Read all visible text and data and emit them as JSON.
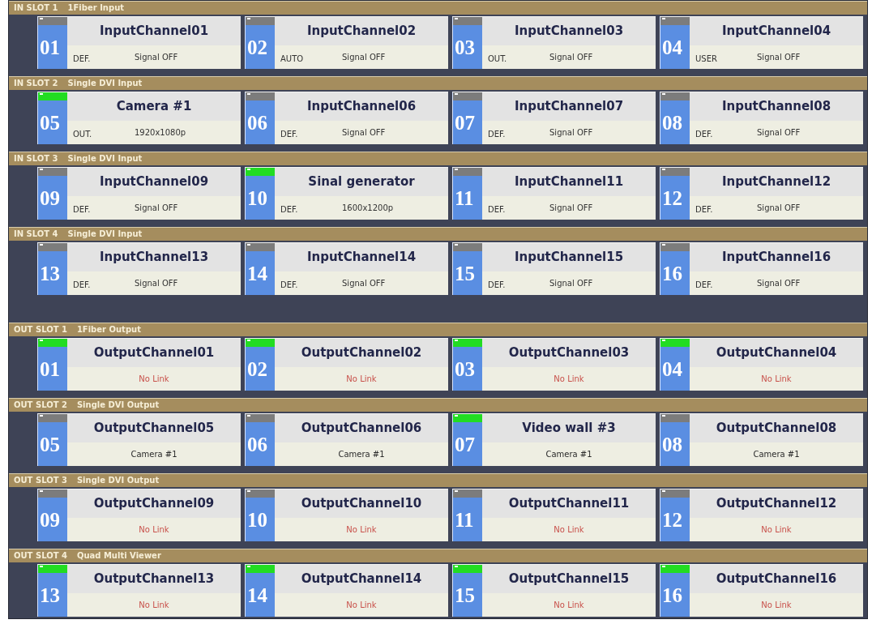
{
  "input_slots": [
    {
      "label": "IN SLOT 1",
      "module": "1Fiber Input",
      "channels": [
        {
          "number": "01",
          "name": "InputChannel01",
          "mode": "DEF.",
          "status": "Signal OFF",
          "active": false
        },
        {
          "number": "02",
          "name": "InputChannel02",
          "mode": "AUTO",
          "status": "Signal OFF",
          "active": false
        },
        {
          "number": "03",
          "name": "InputChannel03",
          "mode": "OUT.",
          "status": "Signal OFF",
          "active": false
        },
        {
          "number": "04",
          "name": "InputChannel04",
          "mode": "USER",
          "status": "Signal OFF",
          "active": false
        }
      ]
    },
    {
      "label": "IN SLOT 2",
      "module": "Single DVI Input",
      "channels": [
        {
          "number": "05",
          "name": "Camera #1",
          "mode": "OUT.",
          "status": "1920x1080p",
          "active": true
        },
        {
          "number": "06",
          "name": "InputChannel06",
          "mode": "DEF.",
          "status": "Signal OFF",
          "active": false
        },
        {
          "number": "07",
          "name": "InputChannel07",
          "mode": "DEF.",
          "status": "Signal OFF",
          "active": false
        },
        {
          "number": "08",
          "name": "InputChannel08",
          "mode": "DEF.",
          "status": "Signal OFF",
          "active": false
        }
      ]
    },
    {
      "label": "IN SLOT 3",
      "module": "Single DVI Input",
      "channels": [
        {
          "number": "09",
          "name": "InputChannel09",
          "mode": "DEF.",
          "status": "Signal OFF",
          "active": false
        },
        {
          "number": "10",
          "name": "Sinal generator",
          "mode": "DEF.",
          "status": "1600x1200p",
          "active": true
        },
        {
          "number": "11",
          "name": "InputChannel11",
          "mode": "DEF.",
          "status": "Signal OFF",
          "active": false
        },
        {
          "number": "12",
          "name": "InputChannel12",
          "mode": "DEF.",
          "status": "Signal OFF",
          "active": false
        }
      ]
    },
    {
      "label": "IN SLOT 4",
      "module": "Single DVI Input",
      "channels": [
        {
          "number": "13",
          "name": "InputChannel13",
          "mode": "DEF.",
          "status": "Signal OFF",
          "active": false
        },
        {
          "number": "14",
          "name": "InputChannel14",
          "mode": "DEF.",
          "status": "Signal OFF",
          "active": false
        },
        {
          "number": "15",
          "name": "InputChannel15",
          "mode": "DEF.",
          "status": "Signal OFF",
          "active": false
        },
        {
          "number": "16",
          "name": "InputChannel16",
          "mode": "DEF.",
          "status": "Signal OFF",
          "active": false
        }
      ]
    }
  ],
  "output_slots": [
    {
      "label": "OUT SLOT 1",
      "module": "1Fiber Output",
      "channels": [
        {
          "number": "01",
          "name": "OutputChannel01",
          "status": "No Link",
          "kind": "no-link",
          "active": true
        },
        {
          "number": "02",
          "name": "OutputChannel02",
          "status": "No Link",
          "kind": "no-link",
          "active": true
        },
        {
          "number": "03",
          "name": "OutputChannel03",
          "status": "No Link",
          "kind": "no-link",
          "active": true
        },
        {
          "number": "04",
          "name": "OutputChannel04",
          "status": "No Link",
          "kind": "no-link",
          "active": true
        }
      ]
    },
    {
      "label": "OUT SLOT 2",
      "module": "Single DVI Output",
      "channels": [
        {
          "number": "05",
          "name": "OutputChannel05",
          "status": "Camera #1",
          "kind": "source",
          "active": false
        },
        {
          "number": "06",
          "name": "OutputChannel06",
          "status": "Camera #1",
          "kind": "source",
          "active": false
        },
        {
          "number": "07",
          "name": "Video wall #3",
          "status": "Camera #1",
          "kind": "source",
          "active": true
        },
        {
          "number": "08",
          "name": "OutputChannel08",
          "status": "Camera #1",
          "kind": "source",
          "active": false
        }
      ]
    },
    {
      "label": "OUT SLOT 3",
      "module": "Single DVI Output",
      "channels": [
        {
          "number": "09",
          "name": "OutputChannel09",
          "status": "No Link",
          "kind": "no-link",
          "active": false
        },
        {
          "number": "10",
          "name": "OutputChannel10",
          "status": "No Link",
          "kind": "no-link",
          "active": false
        },
        {
          "number": "11",
          "name": "OutputChannel11",
          "status": "No Link",
          "kind": "no-link",
          "active": false
        },
        {
          "number": "12",
          "name": "OutputChannel12",
          "status": "No Link",
          "kind": "no-link",
          "active": false
        }
      ]
    },
    {
      "label": "OUT SLOT 4",
      "module": "Quad Multi Viewer",
      "channels": [
        {
          "number": "13",
          "name": "OutputChannel13",
          "status": "No Link",
          "kind": "no-link",
          "active": true
        },
        {
          "number": "14",
          "name": "OutputChannel14",
          "status": "No Link",
          "kind": "no-link",
          "active": true
        },
        {
          "number": "15",
          "name": "OutputChannel15",
          "status": "No Link",
          "kind": "no-link",
          "active": true
        },
        {
          "number": "16",
          "name": "OutputChannel16",
          "status": "No Link",
          "kind": "no-link",
          "active": true
        }
      ]
    }
  ]
}
